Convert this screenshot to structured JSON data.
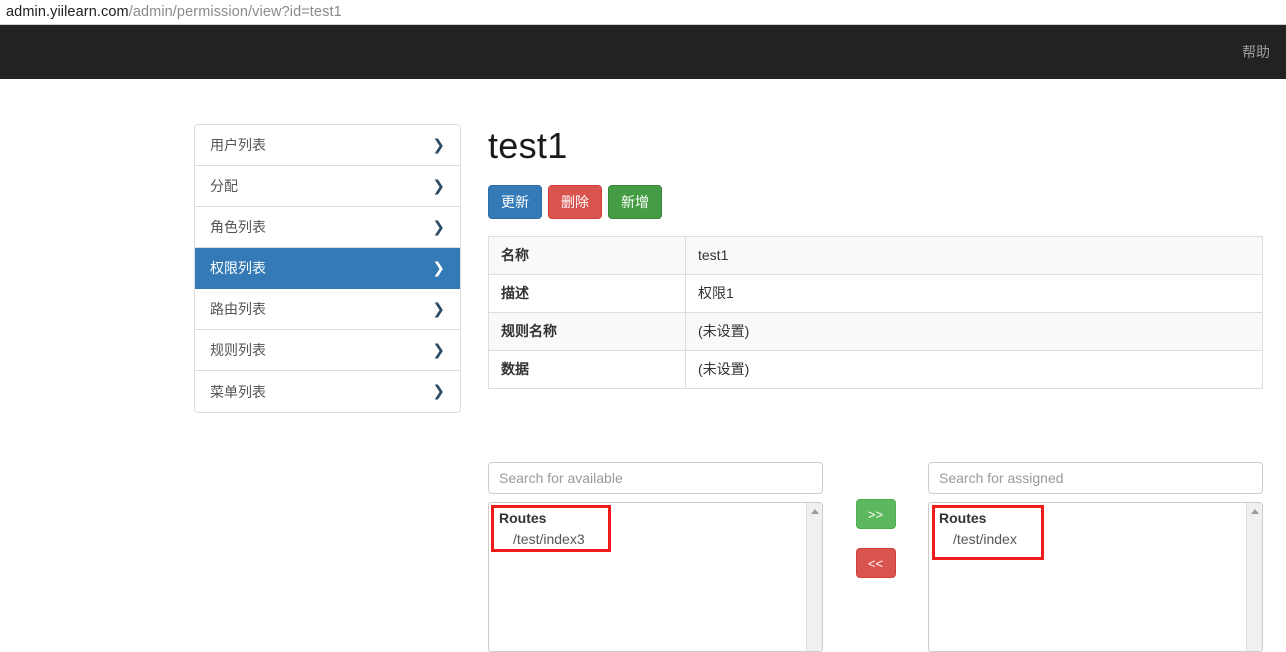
{
  "browser": {
    "url_host": "admin.yiilearn.com",
    "url_path": "/admin/permission/view?id=test1"
  },
  "navbar": {
    "help_label": "帮助"
  },
  "sidebar": {
    "items": [
      {
        "label": "用户列表",
        "active": false
      },
      {
        "label": "分配",
        "active": false
      },
      {
        "label": "角色列表",
        "active": false
      },
      {
        "label": "权限列表",
        "active": true
      },
      {
        "label": "路由列表",
        "active": false
      },
      {
        "label": "规则列表",
        "active": false
      },
      {
        "label": "菜单列表",
        "active": false
      }
    ],
    "chevron": "❯"
  },
  "main": {
    "title": "test1",
    "buttons": {
      "update": "更新",
      "delete": "删除",
      "create": "新增"
    },
    "detail_table": {
      "rows": [
        {
          "label": "名称",
          "value": "test1"
        },
        {
          "label": "描述",
          "value": "权限1"
        },
        {
          "label": "规则名称",
          "value": "(未设置)"
        },
        {
          "label": "数据",
          "value": "(未设置)"
        }
      ]
    }
  },
  "transfer": {
    "available": {
      "placeholder": "Search for available",
      "group_label": "Routes",
      "items": [
        "/test/index3"
      ]
    },
    "assigned": {
      "placeholder": "Search for assigned",
      "group_label": "Routes",
      "items": [
        "/test/index"
      ]
    },
    "buttons": {
      "add": ">>",
      "remove": "<<"
    }
  },
  "colors": {
    "navbar_bg": "#222222",
    "primary": "#337ab7",
    "danger": "#d9534f",
    "success": "#449d44",
    "annotation": "#ee1b1b"
  }
}
